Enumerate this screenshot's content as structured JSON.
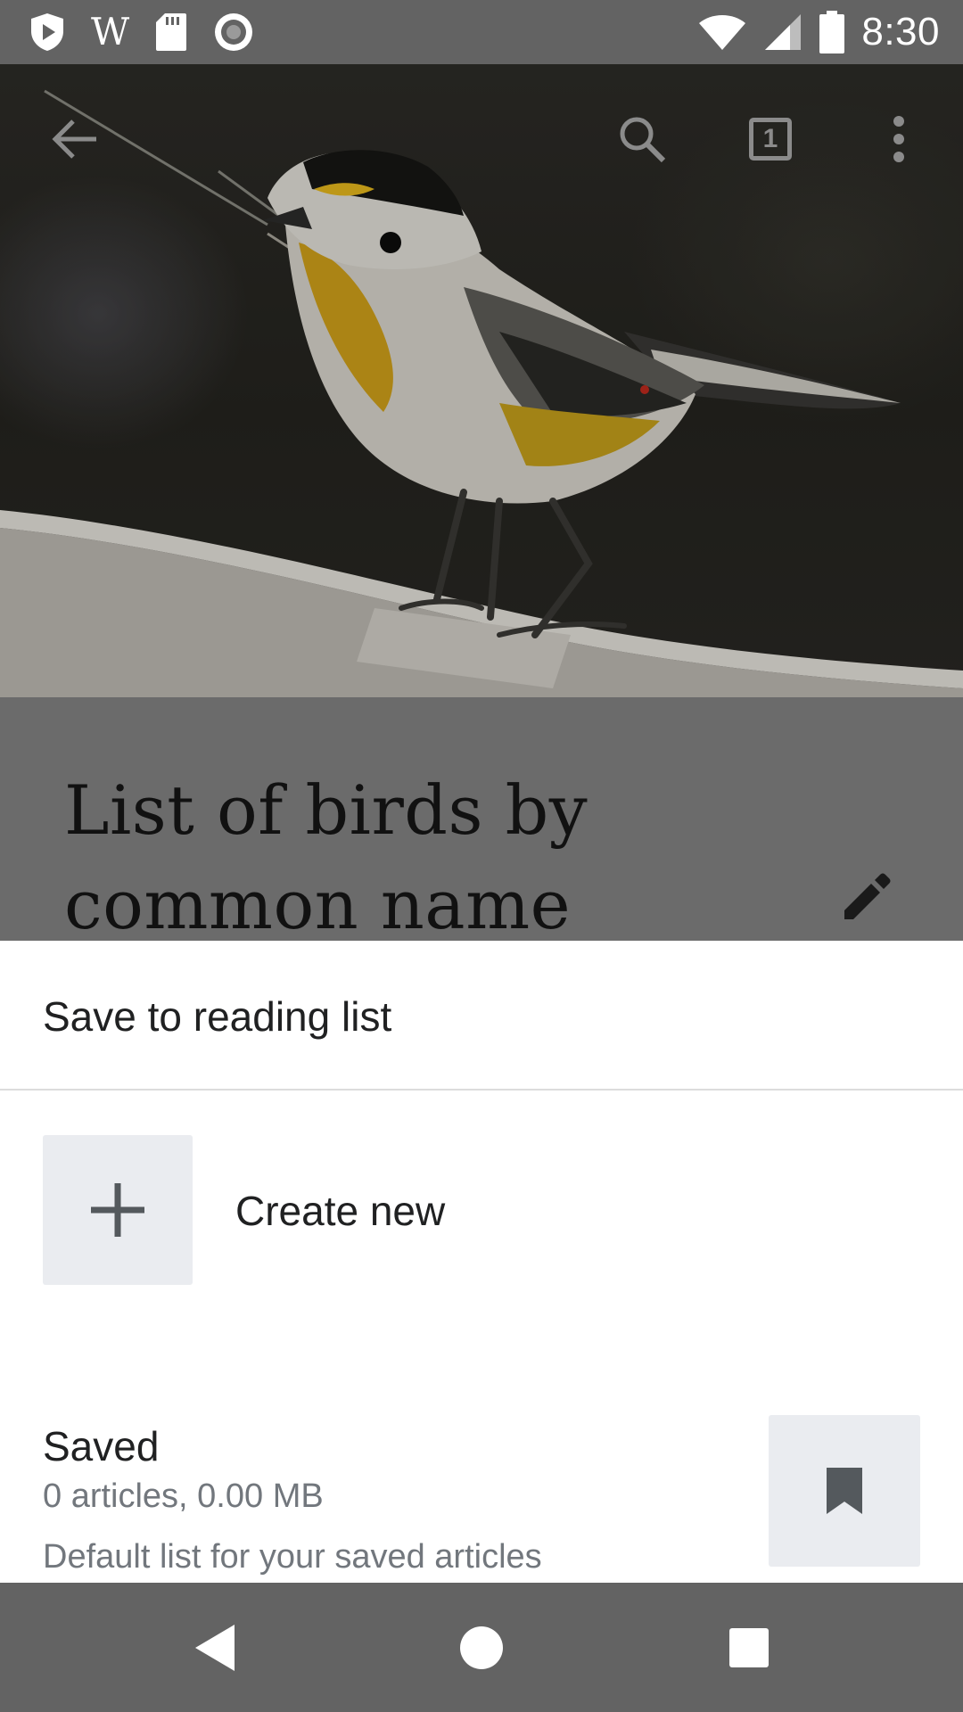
{
  "status_bar": {
    "time": "8:30",
    "left_icons": [
      "play-shield-icon",
      "wikipedia-icon",
      "sd-card-icon",
      "record-icon"
    ],
    "wiki_glyph": "W",
    "right_icons": [
      "wifi-icon",
      "cell-signal-icon",
      "battery-icon"
    ]
  },
  "toolbar": {
    "tab_count": "1",
    "icons": [
      "back-arrow-icon",
      "search-icon",
      "tabs-icon",
      "more-vert-icon"
    ]
  },
  "article": {
    "title_line1": "List of birds by",
    "title_line2": "common name",
    "hero_image": "bird-photo"
  },
  "sheet": {
    "title": "Save to reading list",
    "create_label": "Create new",
    "lists": [
      {
        "name": "Saved",
        "meta": "0 articles, 0.00 MB",
        "description": "Default list for your saved articles"
      }
    ]
  },
  "colors": {
    "sheet_bg": "#ffffff",
    "tile_bg": "#eaecf0",
    "text_primary": "#202122",
    "text_secondary": "#72777d",
    "scrim": "#6b6b6b"
  }
}
